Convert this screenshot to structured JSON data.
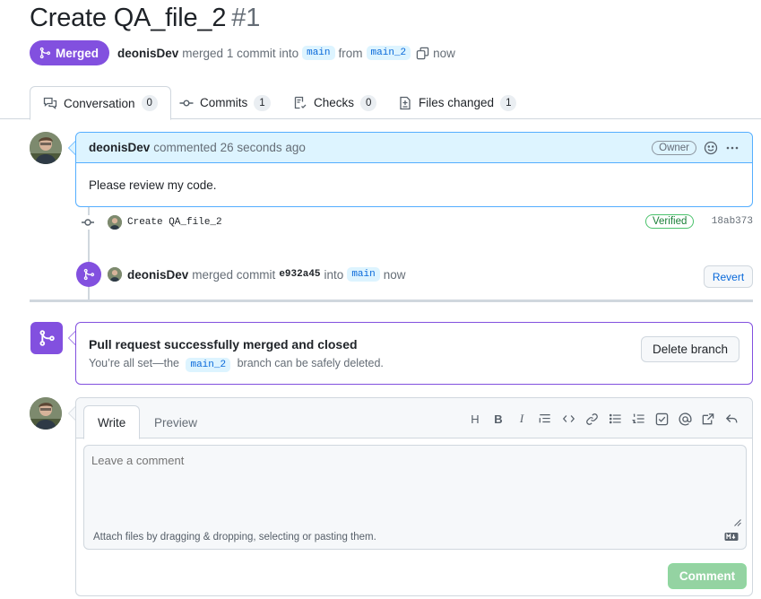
{
  "header": {
    "title": "Create QA_file_2",
    "number": "#1",
    "state_label": "Merged",
    "author": "deonisDev",
    "merge_text": "merged 1 commit into",
    "base_branch": "main",
    "from_text": "from",
    "head_branch": "main_2",
    "time": "now"
  },
  "tabs": [
    {
      "label": "Conversation",
      "count": "0"
    },
    {
      "label": "Commits",
      "count": "1"
    },
    {
      "label": "Checks",
      "count": "0"
    },
    {
      "label": "Files changed",
      "count": "1"
    }
  ],
  "comment": {
    "author": "deonisDev",
    "action": "commented 26 seconds ago",
    "role": "Owner",
    "body": "Please review my code."
  },
  "commit": {
    "message": "Create QA_file_2",
    "verified_label": "Verified",
    "sha": "18ab373"
  },
  "merge_event": {
    "author": "deonisDev",
    "text": "merged commit",
    "sha": "e932a45",
    "into": "into",
    "branch": "main",
    "time": "now",
    "revert_label": "Revert"
  },
  "merged_box": {
    "title": "Pull request successfully merged and closed",
    "sub_pre": "You’re all set—the",
    "branch": "main_2",
    "sub_post": "branch can be safely deleted.",
    "delete_label": "Delete branch"
  },
  "new_comment": {
    "write_tab": "Write",
    "preview_tab": "Preview",
    "placeholder": "Leave a comment",
    "attach_text": "Attach files by dragging & dropping, selecting or pasting them.",
    "submit_label": "Comment",
    "toolbar": {
      "heading": "H",
      "bold": "B",
      "italic": "I"
    }
  },
  "colors": {
    "merged_purple": "#8250df",
    "link_blue": "#0969da",
    "verified_green": "#1a7f37"
  }
}
